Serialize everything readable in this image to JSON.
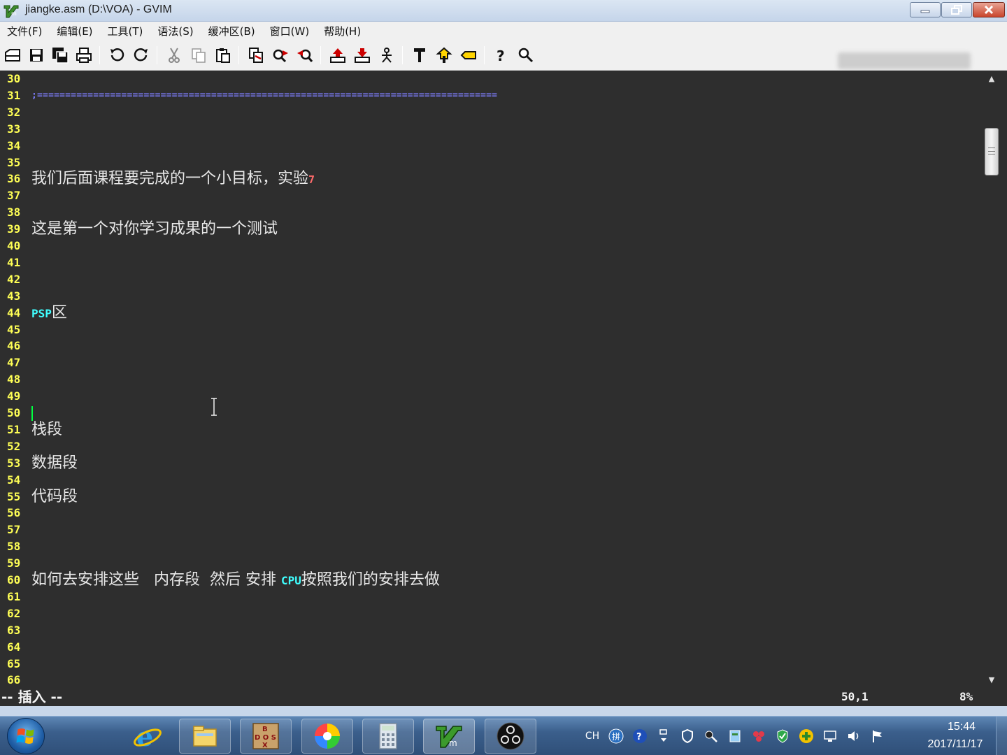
{
  "window": {
    "title": "jiangke.asm (D:\\VOA) - GVIM"
  },
  "menu": {
    "items": [
      "文件(F)",
      "编辑(E)",
      "工具(T)",
      "语法(S)",
      "缓冲区(B)",
      "窗口(W)",
      "帮助(H)"
    ]
  },
  "toolbar": {
    "icons": [
      "open-icon",
      "save-icon",
      "save-all-icon",
      "print-icon",
      "undo-icon",
      "redo-icon",
      "cut-icon",
      "copy-icon",
      "paste-icon",
      "find-replace-icon",
      "find-next-icon",
      "find-prev-icon",
      "load-session-icon",
      "save-session-icon",
      "run-script-icon",
      "make-icon",
      "shell-icon",
      "tag-jump-icon",
      "help-icon",
      "find-help-icon"
    ]
  },
  "editor": {
    "lines": [
      {
        "num": "30",
        "text": ""
      },
      {
        "num": "31",
        "text": ";=================================================================================="
      },
      {
        "num": "32",
        "text": ""
      },
      {
        "num": "33",
        "text": ""
      },
      {
        "num": "34",
        "text": ""
      },
      {
        "num": "35",
        "text": ""
      },
      {
        "num": "36",
        "text": "我们后面课程要完成的一个小目标，实验",
        "suffix": "7"
      },
      {
        "num": "37",
        "text": ""
      },
      {
        "num": "38",
        "text": ""
      },
      {
        "num": "39",
        "text": "这是第一个对你学习成果的一个测试"
      },
      {
        "num": "40",
        "text": ""
      },
      {
        "num": "41",
        "text": ""
      },
      {
        "num": "42",
        "text": ""
      },
      {
        "num": "43",
        "text": ""
      },
      {
        "num": "44",
        "prefix": "PSP",
        "text": "区"
      },
      {
        "num": "45",
        "text": ""
      },
      {
        "num": "46",
        "text": ""
      },
      {
        "num": "47",
        "text": ""
      },
      {
        "num": "48",
        "text": ""
      },
      {
        "num": "49",
        "text": ""
      },
      {
        "num": "50",
        "text": ""
      },
      {
        "num": "51",
        "text": "栈段"
      },
      {
        "num": "52",
        "text": ""
      },
      {
        "num": "53",
        "text": "数据段"
      },
      {
        "num": "54",
        "text": ""
      },
      {
        "num": "55",
        "text": "代码段"
      },
      {
        "num": "56",
        "text": ""
      },
      {
        "num": "57",
        "text": ""
      },
      {
        "num": "58",
        "text": ""
      },
      {
        "num": "59",
        "text": ""
      },
      {
        "num": "60",
        "text": "如何去安排这些   内存段  然后 安排 ",
        "mid": "CPU",
        "tail": "按照我们的安排去做"
      },
      {
        "num": "61",
        "text": ""
      },
      {
        "num": "62",
        "text": ""
      },
      {
        "num": "63",
        "text": ""
      },
      {
        "num": "64",
        "text": ""
      },
      {
        "num": "65",
        "text": ""
      },
      {
        "num": "66",
        "text": ""
      }
    ],
    "cursor_line": "50"
  },
  "status": {
    "mode": "-- 插入 --",
    "position": "50,1",
    "percent": "8%"
  },
  "taskbar": {
    "apps": [
      "ie-icon",
      "file-explorer-icon",
      "dosbox-icon",
      "color-picker-icon",
      "calculator-icon",
      "gvim-icon",
      "obs-icon"
    ],
    "tray": {
      "language": "CH"
    },
    "clock": {
      "time": "15:44",
      "date": "2017/11/17"
    }
  },
  "colors": {
    "editor_bg": "#2e2e2e",
    "line_number": "#ffff55",
    "separator": "#7f7fff",
    "keyword_cyan": "#40ffff",
    "cursor": "#00ff40"
  }
}
